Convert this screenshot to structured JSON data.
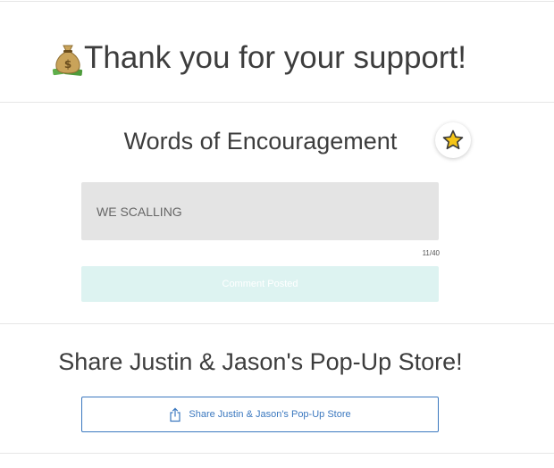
{
  "header": {
    "title": "Thank you for your support!",
    "icon": "money-bag-icon"
  },
  "encouragement": {
    "title": "Words of Encouragement",
    "star_icon": "star-icon",
    "comment_value": "WE SCALLING",
    "counter": "11/40",
    "posted_button_label": "Comment Posted",
    "posted_button_color": "#ddf3f1"
  },
  "share": {
    "title": "Share Justin & Jason's Pop-Up Store!",
    "button_label": "Share Justin & Jason's Pop-Up Store",
    "button_icon": "share-icon",
    "accent_color": "#3b78bf"
  }
}
